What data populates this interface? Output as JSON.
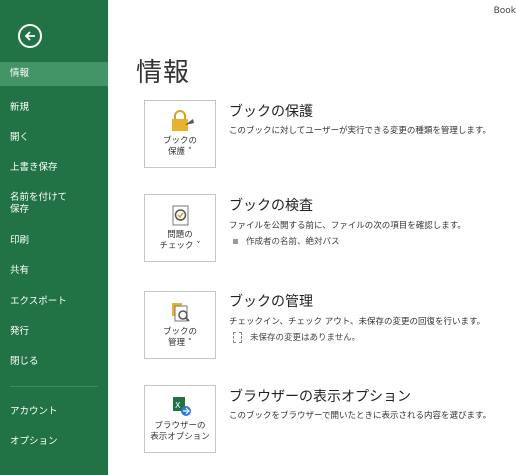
{
  "book_title": "Book",
  "sidebar": {
    "items": [
      {
        "label": "情報"
      },
      {
        "label": "新規"
      },
      {
        "label": "開く"
      },
      {
        "label": "上書き保存"
      },
      {
        "label": "名前を付けて\n保存"
      },
      {
        "label": "印刷"
      },
      {
        "label": "共有"
      },
      {
        "label": "エクスポート"
      },
      {
        "label": "発行"
      },
      {
        "label": "閉じる"
      },
      {
        "label": "アカウント"
      },
      {
        "label": "オプション"
      }
    ]
  },
  "page_title": "情報",
  "sections": [
    {
      "tile_label": "ブックの\n保護 ˅",
      "title": "ブックの保護",
      "desc": "このブックに対してユーザーが実行できる変更の種類を管理します。"
    },
    {
      "tile_label": "問題の\nチェック ˅",
      "title": "ブックの検査",
      "desc": "ファイルを公開する前に、ファイルの次の項目を確認します。",
      "item": "作成者の名前、絶対パス"
    },
    {
      "tile_label": "ブックの\n管理 ˅",
      "title": "ブックの管理",
      "desc": "チェックイン、チェック アウト、未保存の変更の回復を行います。",
      "item": "未保存の変更はありません。"
    },
    {
      "tile_label": "ブラウザーの\n表示オプション",
      "title": "ブラウザーの表示オプション",
      "desc": "このブックをブラウザーで開いたときに表示される内容を選びます。"
    }
  ],
  "colors": {
    "sidebar": "#217346",
    "active": "#439467"
  }
}
